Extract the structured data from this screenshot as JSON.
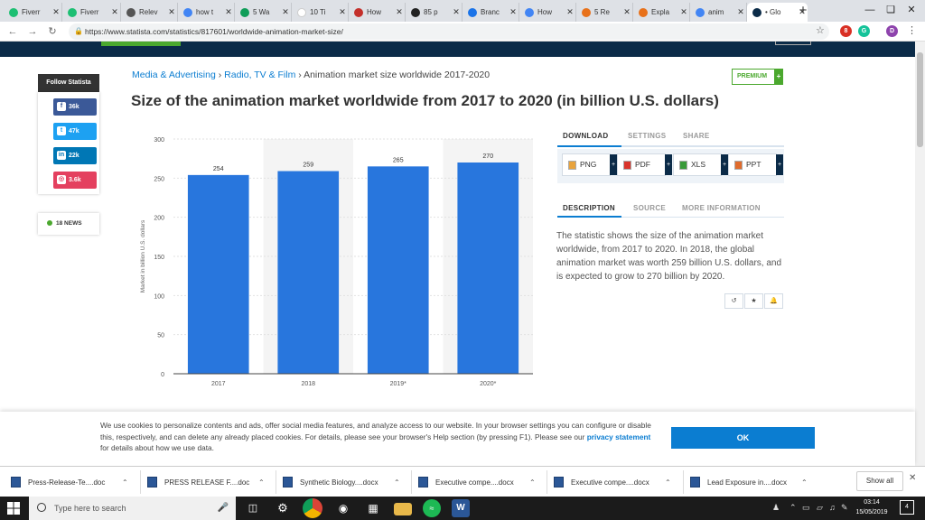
{
  "browser": {
    "tabs": [
      {
        "title": "Fiverr",
        "color": "#1dbf73",
        "glyph": "fi"
      },
      {
        "title": "Fiverr",
        "color": "#1dbf73",
        "glyph": "fi"
      },
      {
        "title": "Relev",
        "color": "#555555",
        "glyph": "globe"
      },
      {
        "title": "how t",
        "color": "#4285f4",
        "glyph": "G"
      },
      {
        "title": "5 Wa",
        "color": "#0f9d58",
        "glyph": "doc"
      },
      {
        "title": "10 Ti",
        "color": "#ffffff",
        "glyph": ""
      },
      {
        "title": "How",
        "color": "#c4302b",
        "glyph": "v"
      },
      {
        "title": "85 p",
        "color": "#222222",
        "glyph": "D"
      },
      {
        "title": "Branc",
        "color": "#1a73e8",
        "glyph": "star"
      },
      {
        "title": "How",
        "color": "#4285f4",
        "glyph": "drive"
      },
      {
        "title": "5 Re",
        "color": "#e8711a",
        "glyph": "o"
      },
      {
        "title": "Expla",
        "color": "#e8711a",
        "glyph": "o"
      },
      {
        "title": "anim",
        "color": "#4285f4",
        "glyph": "G"
      },
      {
        "title": "• Glo",
        "color": "#0b2b48",
        "glyph": "s"
      }
    ],
    "url": "https://www.statista.com/statistics/817601/worldwide-animation-market-size/",
    "avatar_letter": "D",
    "ext_badge": "8"
  },
  "social": {
    "header": "Follow Statista",
    "items": [
      {
        "network": "facebook",
        "count": "36k",
        "color": "#3b5998",
        "glyph": "f"
      },
      {
        "network": "twitter",
        "count": "47k",
        "color": "#1da1f2",
        "glyph": "t"
      },
      {
        "network": "linkedin",
        "count": "22k",
        "color": "#0077b5",
        "glyph": "in"
      },
      {
        "network": "instagram",
        "count": "3.6k",
        "color": "#e4405f",
        "glyph": "◎"
      }
    ],
    "news": "18 NEWS"
  },
  "breadcrumb": {
    "items": [
      "Media & Advertising",
      "Radio, TV & Film"
    ],
    "separator": "›",
    "current": "Animation market size worldwide 2017-2020"
  },
  "premium_label": "PREMIUM",
  "title": "Size of the animation market worldwide from 2017 to 2020 (in billion U.S. dollars)",
  "chart_data": {
    "type": "bar",
    "categories": [
      "2017",
      "2018",
      "2019*",
      "2020*"
    ],
    "values": [
      254,
      259,
      265,
      270
    ],
    "ylabel": "Market in billion U.S. dollars",
    "xlabel": "",
    "ylim": [
      0,
      300
    ],
    "yticks": [
      0,
      50,
      100,
      150,
      200,
      250,
      300
    ],
    "bar_color": "#2876dd",
    "grid": true,
    "data_labels": true
  },
  "panel": {
    "tabs1": [
      "DOWNLOAD",
      "SETTINGS",
      "SHARE"
    ],
    "downloads": [
      {
        "label": "PNG",
        "color": "#e8a33d"
      },
      {
        "label": "PDF",
        "color": "#d9342b"
      },
      {
        "label": "XLS",
        "color": "#3a9b3a"
      },
      {
        "label": "PPT",
        "color": "#e06b2c"
      }
    ],
    "tabs2": [
      "DESCRIPTION",
      "SOURCE",
      "MORE INFORMATION"
    ],
    "description": "The statistic shows the size of the animation market worldwide, from 2017 to 2020. In 2018, the global animation market was worth 259 billion U.S. dollars, and is expected to grow to 270 billion by 2020.",
    "actions": [
      "↺",
      "★",
      "🔔"
    ]
  },
  "cookie": {
    "text": "We use cookies to personalize contents and ads, offer social media features, and analyze access to our website. In your browser settings you can configure or disable this, respectively, and can delete any already placed cookies. For details, please see your browser's Help section (by pressing F1). Please see our",
    "link": "privacy statement",
    "text_after": "for details about how we use data.",
    "ok": "OK"
  },
  "downloads_shelf": {
    "files": [
      "Press-Release-Te....doc",
      "PRESS RELEASE F....doc",
      "Synthetic Biology....docx",
      "Executive compe....docx",
      "Executive compe....docx",
      "Lead Exposure in....docx"
    ],
    "show_all": "Show all"
  },
  "taskbar": {
    "search_placeholder": "Type here to search",
    "time": "03:14",
    "date": "15/05/2019",
    "notification_count": "4"
  }
}
